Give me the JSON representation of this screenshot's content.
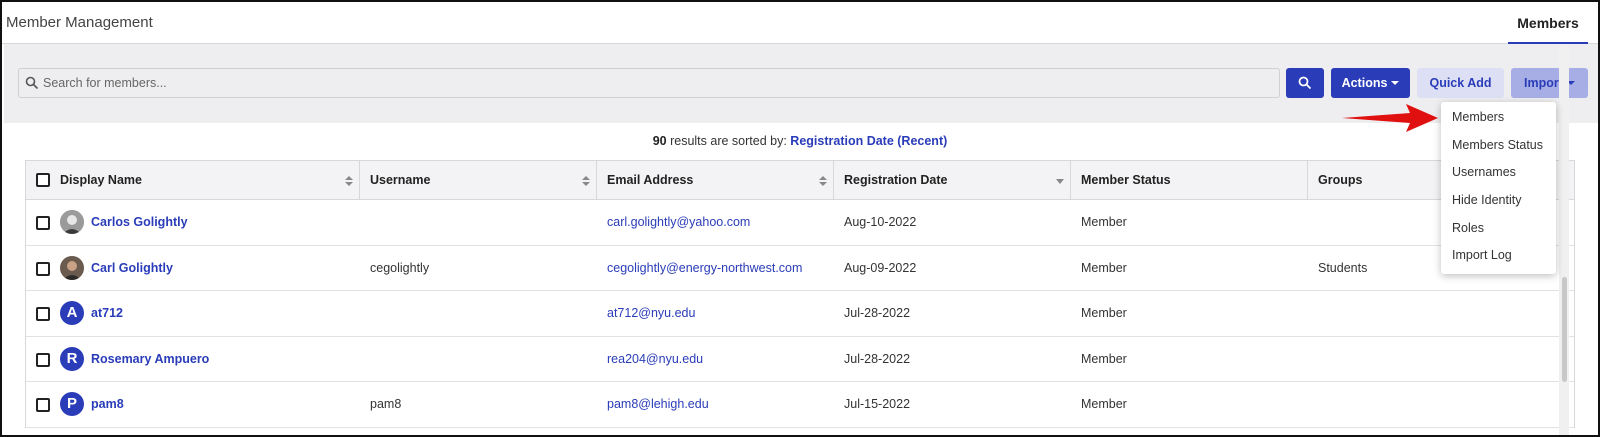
{
  "header": {
    "title": "Member Management",
    "active_tab": "Members"
  },
  "toolbar": {
    "search_placeholder": "Search for members...",
    "actions_label": "Actions",
    "quick_add_label": "Quick Add",
    "import_label": "Import"
  },
  "results": {
    "count": "90",
    "text": "results are sorted by:",
    "sort": "Registration Date (Recent)"
  },
  "table": {
    "columns": [
      "Display Name",
      "Username",
      "Email Address",
      "Registration Date",
      "Member Status",
      "Groups"
    ],
    "rows": [
      {
        "name": "Carlos Golightly",
        "avatar": "photo",
        "username": "",
        "email": "carl.golightly@yahoo.com",
        "date": "Aug-10-2022",
        "status": "Member",
        "groups": ""
      },
      {
        "name": "Carl Golightly",
        "avatar": "photo",
        "username": "cegolightly",
        "email": "cegolightly@energy-northwest.com",
        "date": "Aug-09-2022",
        "status": "Member",
        "groups": "Students"
      },
      {
        "name": "at712",
        "avatar": "A",
        "username": "",
        "email": "at712@nyu.edu",
        "date": "Jul-28-2022",
        "status": "Member",
        "groups": ""
      },
      {
        "name": "Rosemary Ampuero",
        "avatar": "R",
        "username": "",
        "email": "rea204@nyu.edu",
        "date": "Jul-28-2022",
        "status": "Member",
        "groups": ""
      },
      {
        "name": "pam8",
        "avatar": "P",
        "username": "pam8",
        "email": "pam8@lehigh.edu",
        "date": "Jul-15-2022",
        "status": "Member",
        "groups": ""
      }
    ]
  },
  "import_menu": {
    "items": [
      "Members",
      "Members Status",
      "Usernames",
      "Hide Identity",
      "Roles",
      "Import Log"
    ]
  },
  "colors": {
    "accent": "#2a3cb8",
    "arrow": "#e01010"
  }
}
